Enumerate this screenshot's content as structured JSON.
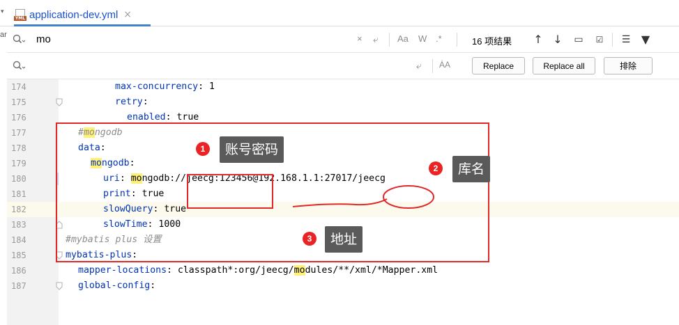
{
  "tab": {
    "title": "application-dev.yml",
    "icon_label": "YML"
  },
  "edge": {
    "letters": "ar"
  },
  "search": {
    "find_value": "mo",
    "replace_value": "",
    "results": "16 项结果",
    "case_option": "Aa",
    "word_option": "W",
    "regex_option": ".*",
    "preserve_case_option": "ȦA",
    "replace_label": "Replace",
    "replace_all_label": "Replace all",
    "exclude_label": "排除"
  },
  "lines": [
    {
      "num": "174",
      "text": "max-concurrency: 1"
    },
    {
      "num": "175",
      "text": "retry:"
    },
    {
      "num": "176",
      "text": "enabled: true"
    },
    {
      "num": "177",
      "text": "#mongodb"
    },
    {
      "num": "178",
      "text": "data:"
    },
    {
      "num": "179",
      "text": "mongodb:"
    },
    {
      "num": "180",
      "text": "uri: mongodb://jeecg:123456@192.168.1.1:27017/jeecg"
    },
    {
      "num": "181",
      "text": "print: true"
    },
    {
      "num": "182",
      "text": "slowQuery: true"
    },
    {
      "num": "183",
      "text": "slowTime: 1000"
    },
    {
      "num": "184",
      "text": "#mybatis plus 设置"
    },
    {
      "num": "185",
      "text": "mybatis-plus:"
    },
    {
      "num": "186",
      "text": "mapper-locations: classpath*:org/jeecg/modules/**/xml/*Mapper.xml"
    },
    {
      "num": "187",
      "text": "global-config:"
    }
  ],
  "annotations": [
    {
      "number": "1",
      "label": "账号密码"
    },
    {
      "number": "2",
      "label": "库名"
    },
    {
      "number": "3",
      "label": "地址"
    }
  ],
  "colors": {
    "annotation_red": "#e02828",
    "keyword_blue": "#0033b3",
    "match_highlight": "#fff07a"
  }
}
